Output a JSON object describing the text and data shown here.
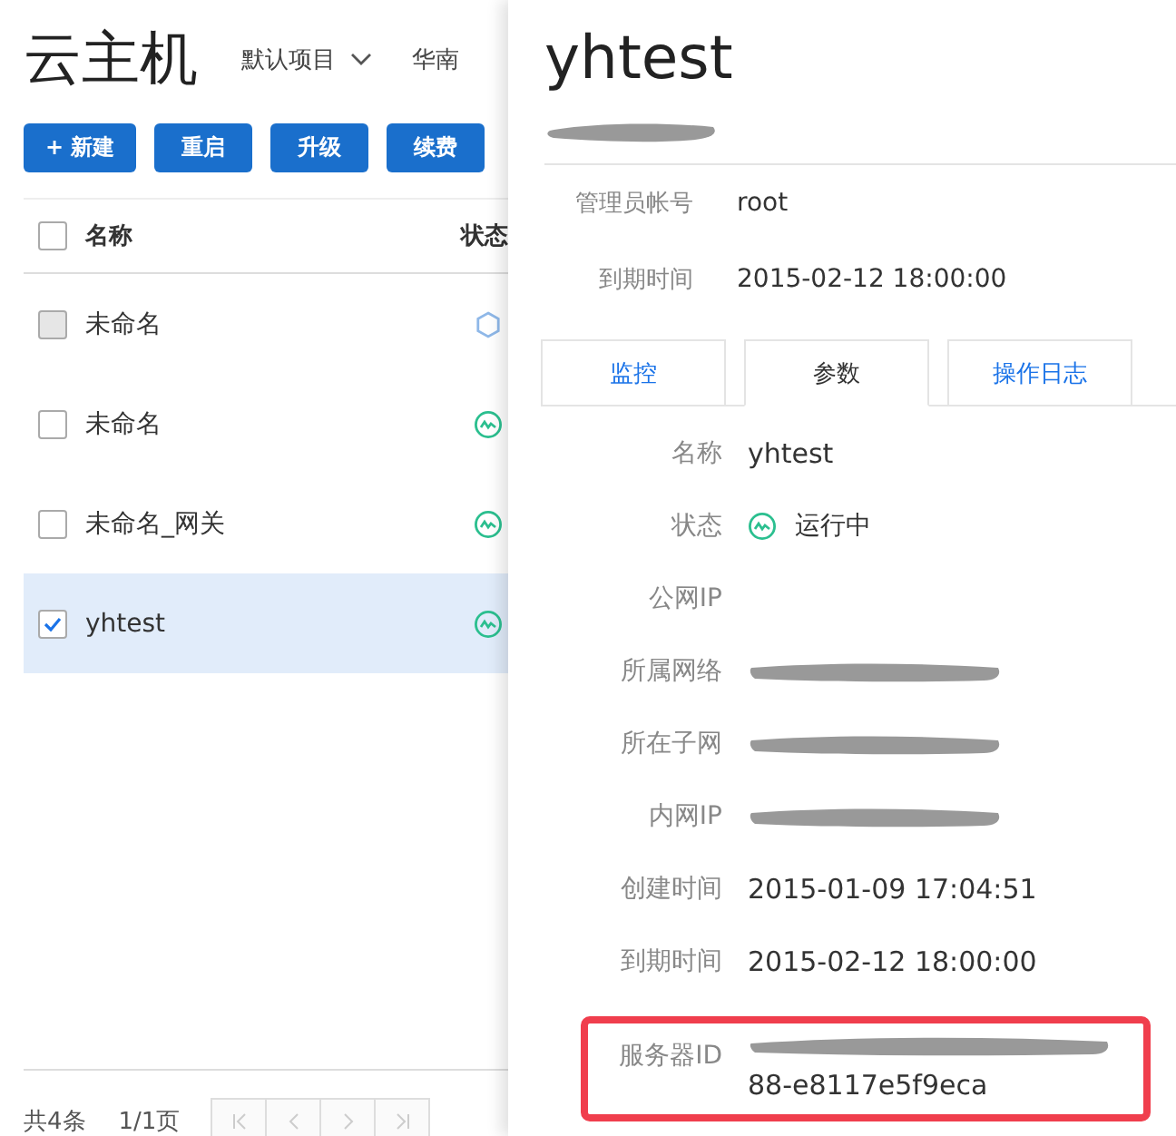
{
  "list_panel": {
    "title": "云主机",
    "project_dropdown": "默认项目",
    "region_dropdown": "华南",
    "buttons": [
      "+ 新建",
      "重启",
      "升级",
      "续费"
    ],
    "table": {
      "columns": [
        "名称",
        "状态"
      ],
      "header_checked": false,
      "rows": [
        {
          "name": "未命名",
          "checked": false,
          "disabled": true,
          "kind": "pending",
          "selected": false
        },
        {
          "name": "未命名",
          "checked": false,
          "disabled": false,
          "kind": "running",
          "selected": false
        },
        {
          "name": "未命名_网关",
          "checked": false,
          "disabled": false,
          "kind": "running",
          "selected": false
        },
        {
          "name": "yhtest",
          "checked": true,
          "disabled": false,
          "kind": "running",
          "selected": true
        }
      ]
    },
    "footer": {
      "total": "共4条",
      "page": "1/1页"
    }
  },
  "detail_panel": {
    "title": "yhtest",
    "subtitle_redacted": true,
    "summary": [
      {
        "label": "管理员帐号",
        "value": "root"
      },
      {
        "label": "到期时间",
        "value": "2015-02-12 18:00:00"
      }
    ],
    "tabs": [
      {
        "label": "监控",
        "selected": false
      },
      {
        "label": "参数",
        "selected": true
      },
      {
        "label": "操作日志",
        "selected": false
      }
    ],
    "fields": [
      {
        "label": "名称",
        "kind": "text",
        "value": "yhtest"
      },
      {
        "label": "状态",
        "kind": "status",
        "value": "运行中"
      },
      {
        "label": "公网IP",
        "kind": "text"
      },
      {
        "label": "所属网络",
        "kind": "redacted"
      },
      {
        "label": "所在子网",
        "kind": "redacted"
      },
      {
        "label": "内网IP",
        "kind": "redacted"
      },
      {
        "label": "创建时间",
        "kind": "text",
        "value": "2015-01-09 17:04:51"
      },
      {
        "label": "到期时间",
        "kind": "text",
        "value": "2015-02-12 18:00:00"
      },
      {
        "label": "服务器ID",
        "kind": "partly_redacted",
        "value": "88-e8117e5f9eca",
        "highlighted": true
      }
    ]
  }
}
